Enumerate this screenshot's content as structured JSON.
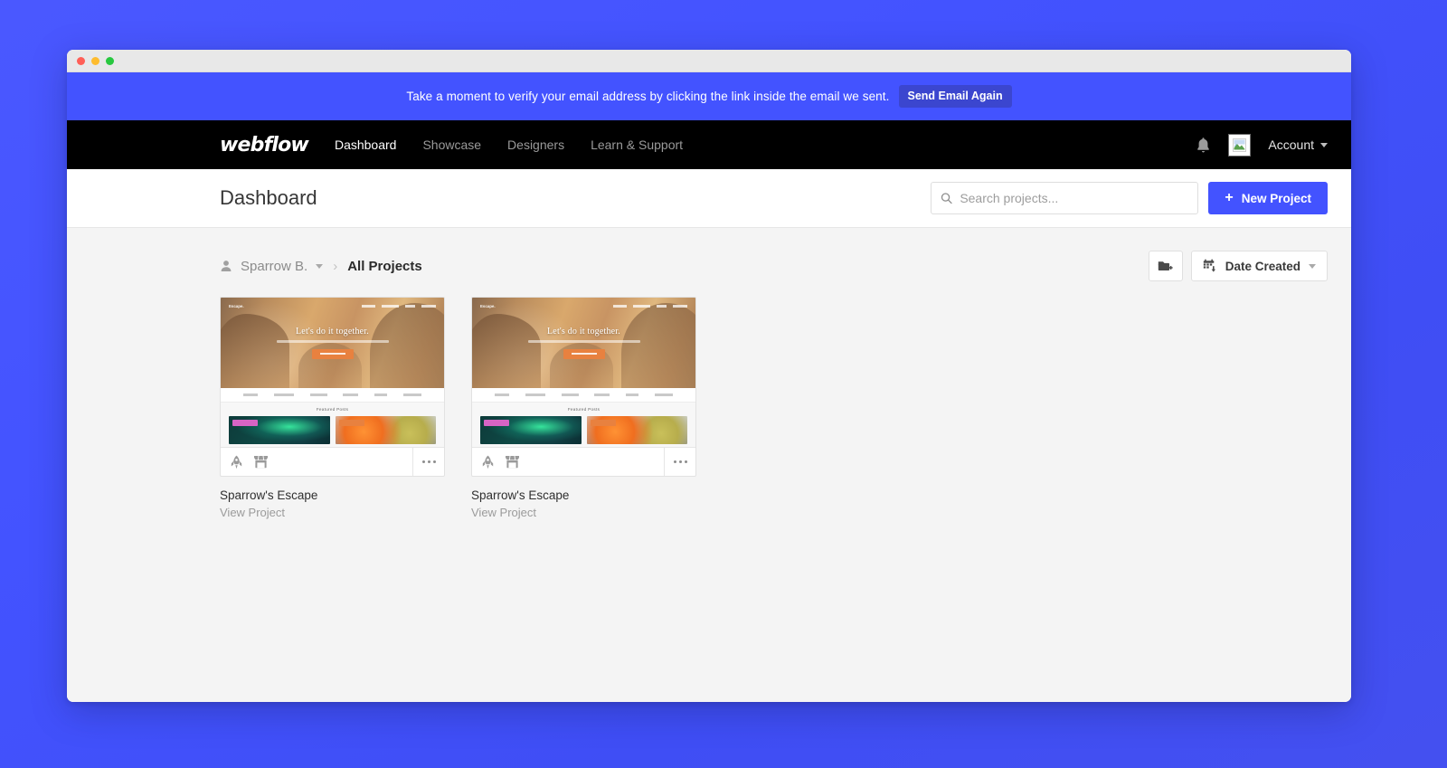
{
  "window": {
    "traffic_lights": [
      "close",
      "minimize",
      "maximize"
    ]
  },
  "banner": {
    "message": "Take a moment to verify your email address by clicking the link inside the email we sent.",
    "button_label": "Send Email Again",
    "background_color": "#4353ff",
    "button_color": "#3b46cf"
  },
  "topnav": {
    "logo": "webflow",
    "links": [
      {
        "label": "Dashboard",
        "active": true
      },
      {
        "label": "Showcase",
        "active": false
      },
      {
        "label": "Designers",
        "active": false
      },
      {
        "label": "Learn & Support",
        "active": false
      }
    ],
    "notifications_icon": "bell-icon",
    "avatar_icon": "broken-image-avatar",
    "account_label": "Account",
    "background_color": "#000000"
  },
  "header": {
    "title": "Dashboard",
    "search": {
      "placeholder": "Search projects...",
      "value": "",
      "icon": "search-icon"
    },
    "new_project_button": {
      "label": "New Project",
      "plus": "+",
      "color": "#4353ff"
    }
  },
  "toolbar": {
    "breadcrumb": {
      "user_icon": "person-icon",
      "user_label": "Sparrow B.",
      "separator": "›",
      "current": "All Projects"
    },
    "new_folder_button": {
      "icon": "folder-plus-icon",
      "label": ""
    },
    "sort": {
      "icon": "calendar-arrow-down-icon",
      "label": "Date Created",
      "caret": "chevron-down-icon"
    }
  },
  "projects": [
    {
      "name": "Sparrow's Escape",
      "link_label": "View Project",
      "thumbnail": {
        "site_logo": "Escape.",
        "headline": "Let's do it together.",
        "cta": "View Latest Posts",
        "featured_title": "Featured Posts",
        "nav_items": 4,
        "category_items": 6,
        "posts": [
          {
            "tag_color": "#d764c4",
            "theme": "aurora"
          },
          {
            "tag_color": "#e8813f",
            "theme": "balloons"
          }
        ]
      },
      "actions": [
        {
          "icon": "rocket-icon",
          "name": "publish"
        },
        {
          "icon": "store-icon",
          "name": "ecommerce"
        }
      ],
      "more_menu": "more-options-icon"
    },
    {
      "name": "Sparrow's Escape",
      "link_label": "View Project",
      "thumbnail": {
        "site_logo": "Escape.",
        "headline": "Let's do it together.",
        "cta": "View Latest Posts",
        "featured_title": "Featured Posts",
        "nav_items": 4,
        "category_items": 6,
        "posts": [
          {
            "tag_color": "#d764c4",
            "theme": "aurora"
          },
          {
            "tag_color": "#e8813f",
            "theme": "balloons"
          }
        ]
      },
      "actions": [
        {
          "icon": "rocket-icon",
          "name": "publish"
        },
        {
          "icon": "store-icon",
          "name": "ecommerce"
        }
      ],
      "more_menu": "more-options-icon"
    }
  ],
  "colors": {
    "page_background": "#4353ff",
    "content_background": "#f4f4f4",
    "accent": "#4353ff"
  }
}
